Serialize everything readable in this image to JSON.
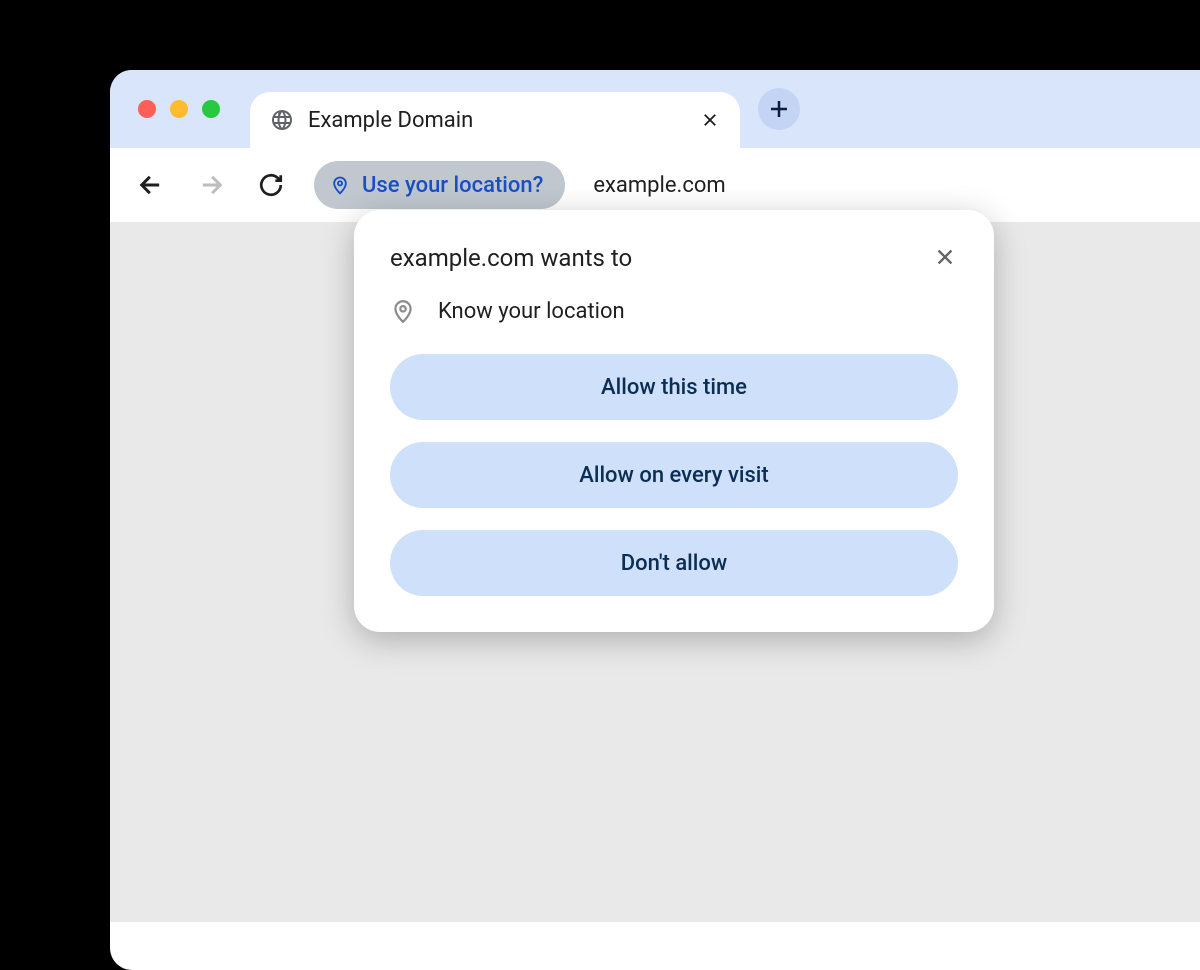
{
  "tab": {
    "title": "Example Domain"
  },
  "omnibox": {
    "permission_chip": "Use your location?",
    "url": "example.com"
  },
  "dialog": {
    "title": "example.com wants to",
    "request": "Know your location",
    "buttons": {
      "allow_once": "Allow this time",
      "allow_always": "Allow on every visit",
      "deny": "Don't allow"
    }
  }
}
